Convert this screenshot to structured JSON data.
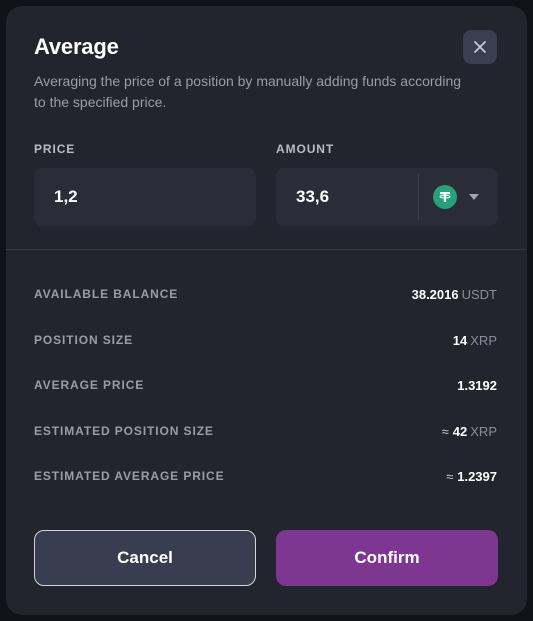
{
  "modal": {
    "title": "Average",
    "description": "Averaging the price of a position by manually adding funds according to the specified price."
  },
  "form": {
    "price_label": "PRICE",
    "price_value": "1,2",
    "amount_label": "AMOUNT",
    "amount_value": "33,6",
    "currency_icon": "tether-usdt-icon"
  },
  "details": [
    {
      "label": "AVAILABLE BALANCE",
      "approx": "",
      "value": "38.2016",
      "unit": "USDT"
    },
    {
      "label": "POSITION SIZE",
      "approx": "",
      "value": "14",
      "unit": "XRP"
    },
    {
      "label": "AVERAGE PRICE",
      "approx": "",
      "value": "1.3192",
      "unit": ""
    },
    {
      "label": "ESTIMATED POSITION SIZE",
      "approx": "≈",
      "value": "42",
      "unit": "XRP"
    },
    {
      "label": "ESTIMATED AVERAGE PRICE",
      "approx": "≈",
      "value": "1.2397",
      "unit": ""
    }
  ],
  "buttons": {
    "cancel_label": "Cancel",
    "confirm_label": "Confirm"
  },
  "colors": {
    "modal_bg": "#22252e",
    "input_bg": "#2a2d37",
    "confirm_bg": "#7d3790",
    "cancel_bg": "#383d50",
    "usdt_green": "#26a17b"
  }
}
